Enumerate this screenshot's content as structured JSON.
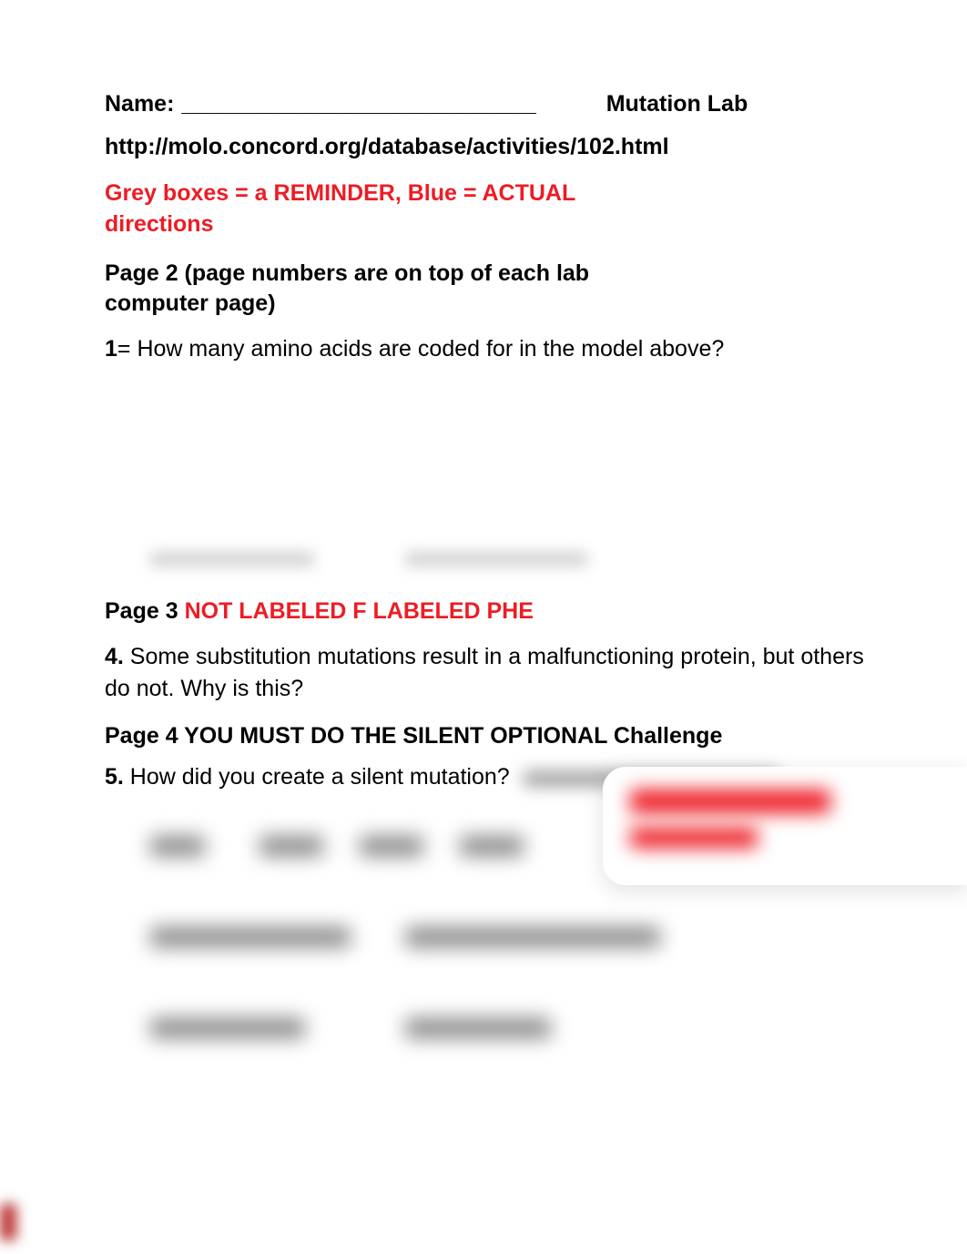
{
  "header": {
    "name_label": "Name:",
    "name_blank": "____________________________",
    "title": "Mutation Lab"
  },
  "url": "http://molo.concord.org/database/activities/102.html",
  "legend": "Grey boxes = a REMINDER, Blue = ACTUAL directions",
  "page2": {
    "heading": "Page 2 (page numbers are on top of each lab computer page)",
    "q1_num": "1",
    "q1_text": "= How many amino acids are coded for in the model above?"
  },
  "page3": {
    "label": "Page 3 ",
    "red_note": "NOT LABELED F LABELED PHE",
    "q4_num": "4.",
    "q4_text": "  Some substitution mutations result in a malfunctioning protein, but others do not.  Why is this?"
  },
  "page4": {
    "heading": "Page 4 YOU MUST DO THE SILENT OPTIONAL Challenge",
    "q5_num": "5.",
    "q5_text": " How did you create a silent mutation?"
  }
}
